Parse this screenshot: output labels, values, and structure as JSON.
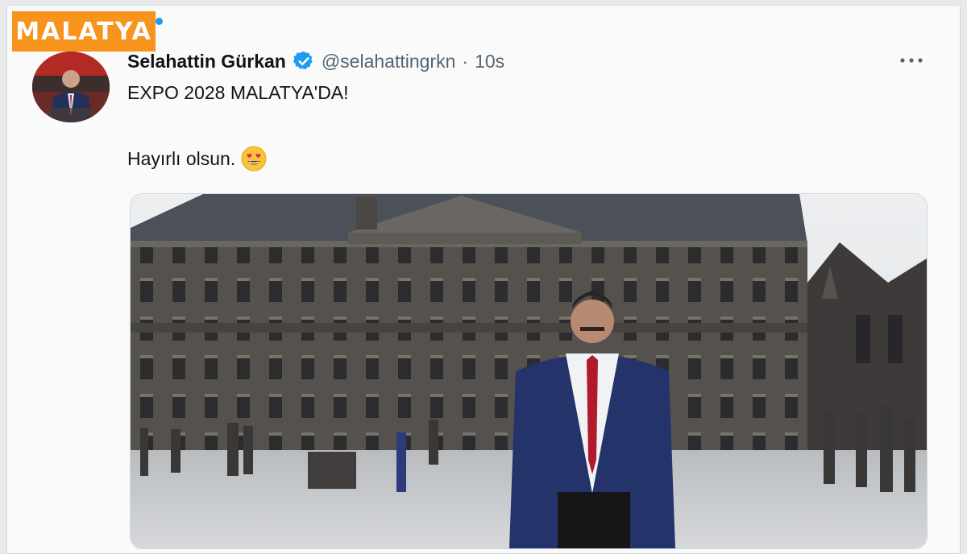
{
  "badge": {
    "text": "MALATYA"
  },
  "tweet": {
    "author_name": "Selahattin Gürkan",
    "handle": "@selahattingrkn",
    "separator": "·",
    "timestamp": "10s",
    "line1": "EXPO 2028 MALATYA'DA!",
    "line2": "Hayırlı olsun.",
    "emoji": "smiling-face-with-heart-eyes"
  },
  "icons": {
    "verified": "verified-badge-icon",
    "more": "more-options-icon"
  },
  "colors": {
    "badge": "#f7941d",
    "verified": "#1d9bf0",
    "text": "#0f1419",
    "secondary": "#536471"
  }
}
